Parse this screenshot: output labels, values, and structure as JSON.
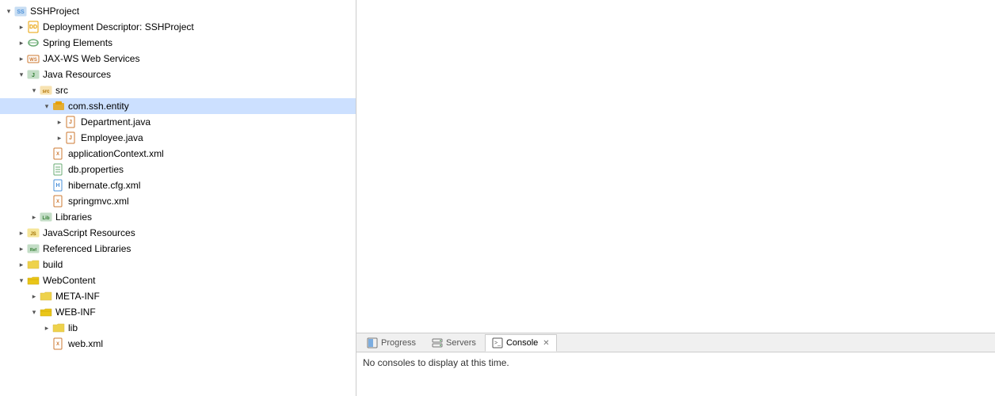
{
  "project": {
    "name": "SSHProject",
    "items": [
      {
        "id": "sshproject",
        "label": "SSHProject",
        "indent": 0,
        "state": "expanded",
        "icon": "project",
        "selected": false
      },
      {
        "id": "deployment",
        "label": "Deployment Descriptor: SSHProject",
        "indent": 1,
        "state": "collapsed",
        "icon": "descriptor",
        "selected": false
      },
      {
        "id": "spring",
        "label": "Spring Elements",
        "indent": 1,
        "state": "collapsed",
        "icon": "spring",
        "selected": false
      },
      {
        "id": "jaxws",
        "label": "JAX-WS Web Services",
        "indent": 1,
        "state": "collapsed",
        "icon": "jaxws",
        "selected": false
      },
      {
        "id": "java-resources",
        "label": "Java Resources",
        "indent": 1,
        "state": "expanded",
        "icon": "java-resources",
        "selected": false
      },
      {
        "id": "src",
        "label": "src",
        "indent": 2,
        "state": "expanded",
        "icon": "src",
        "selected": false
      },
      {
        "id": "package",
        "label": "com.ssh.entity",
        "indent": 3,
        "state": "expanded",
        "icon": "package",
        "selected": true
      },
      {
        "id": "department",
        "label": "Department.java",
        "indent": 4,
        "state": "collapsed",
        "icon": "java",
        "selected": false
      },
      {
        "id": "employee",
        "label": "Employee.java",
        "indent": 4,
        "state": "collapsed",
        "icon": "java",
        "selected": false
      },
      {
        "id": "appcontext",
        "label": "applicationContext.xml",
        "indent": 3,
        "state": "none",
        "icon": "xml",
        "selected": false
      },
      {
        "id": "dbprops",
        "label": "db.properties",
        "indent": 3,
        "state": "none",
        "icon": "properties",
        "selected": false
      },
      {
        "id": "hibernate",
        "label": "hibernate.cfg.xml",
        "indent": 3,
        "state": "none",
        "icon": "xml2",
        "selected": false
      },
      {
        "id": "springmvc",
        "label": "springmvc.xml",
        "indent": 3,
        "state": "none",
        "icon": "xml",
        "selected": false
      },
      {
        "id": "libraries",
        "label": "Libraries",
        "indent": 2,
        "state": "collapsed",
        "icon": "libraries",
        "selected": false
      },
      {
        "id": "js-resources",
        "label": "JavaScript Resources",
        "indent": 1,
        "state": "collapsed",
        "icon": "js-resources",
        "selected": false
      },
      {
        "id": "ref-libraries",
        "label": "Referenced Libraries",
        "indent": 1,
        "state": "collapsed",
        "icon": "ref-libraries",
        "selected": false
      },
      {
        "id": "build",
        "label": "build",
        "indent": 1,
        "state": "collapsed",
        "icon": "folder",
        "selected": false
      },
      {
        "id": "webcontent",
        "label": "WebContent",
        "indent": 1,
        "state": "expanded",
        "icon": "folder-open",
        "selected": false
      },
      {
        "id": "meta-inf",
        "label": "META-INF",
        "indent": 2,
        "state": "collapsed",
        "icon": "folder",
        "selected": false
      },
      {
        "id": "web-inf",
        "label": "WEB-INF",
        "indent": 2,
        "state": "expanded",
        "icon": "folder-open",
        "selected": false
      },
      {
        "id": "lib",
        "label": "lib",
        "indent": 3,
        "state": "collapsed",
        "icon": "folder",
        "selected": false
      },
      {
        "id": "webxml",
        "label": "web.xml",
        "indent": 3,
        "state": "none",
        "icon": "xml",
        "selected": false
      }
    ]
  },
  "bottom": {
    "tabs": [
      {
        "id": "progress",
        "label": "Progress",
        "icon": "progress-icon",
        "active": false
      },
      {
        "id": "servers",
        "label": "Servers",
        "icon": "servers-icon",
        "active": false
      },
      {
        "id": "console",
        "label": "Console",
        "icon": "console-icon",
        "active": true
      }
    ],
    "console_message": "No consoles to display at this time."
  }
}
